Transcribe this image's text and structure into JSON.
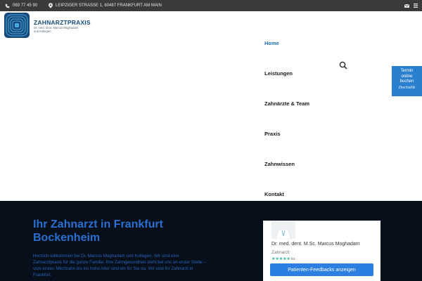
{
  "topbar": {
    "phone": "069 77 45 90",
    "address": "LEIPZIGER STRASSE 1, 60487 FRANKFURT AM MAIN",
    "mail_icon": "mail-icon"
  },
  "brand": {
    "title": "ZAHNARZTPRAXIS",
    "subtitle": "Dr. med. dent. Marcus Moghadam und Kollegen"
  },
  "nav": {
    "items": [
      {
        "label": "Home",
        "active": true
      },
      {
        "label": "Leistungen",
        "active": false
      },
      {
        "label": "Zahnärzte & Team",
        "active": false
      },
      {
        "label": "Praxis",
        "active": false
      },
      {
        "label": "Zahnwissen",
        "active": false
      },
      {
        "label": "Kontakt",
        "active": false
      }
    ]
  },
  "cta": {
    "line1": "Termin",
    "line2": "online",
    "line3": "buchen",
    "brand": "Doctolib"
  },
  "hero": {
    "title_line1": "Ihr Zahnarzt in Frankfurt",
    "title_line2": "Bockenheim",
    "text": "Herzlich willkommen bei Dr. Marcus Moghadam und Kollegen. Wir sind eine Zahnarztpraxis für die ganze Familie. Ihre Zahngesundheit steht bei uns an erster Stelle – vom ersten Milchzahn bis ins hohe Alter sind wir für Sie da. Wir sind Ihr Zahnarzt in Frankfurt."
  },
  "review_card": {
    "name": "Dr. med. dent. M.Sc. Marcus Moghadam",
    "role": "Zahnarzt",
    "stars": "★★★★★",
    "count_text": "ks",
    "button": "Patienten-Feedbacks anzeigen"
  },
  "colors": {
    "accent": "#1f6fb5",
    "cta": "#2a7fcf",
    "hero_bg": "#07101a",
    "stars": "#2bb3a3"
  }
}
